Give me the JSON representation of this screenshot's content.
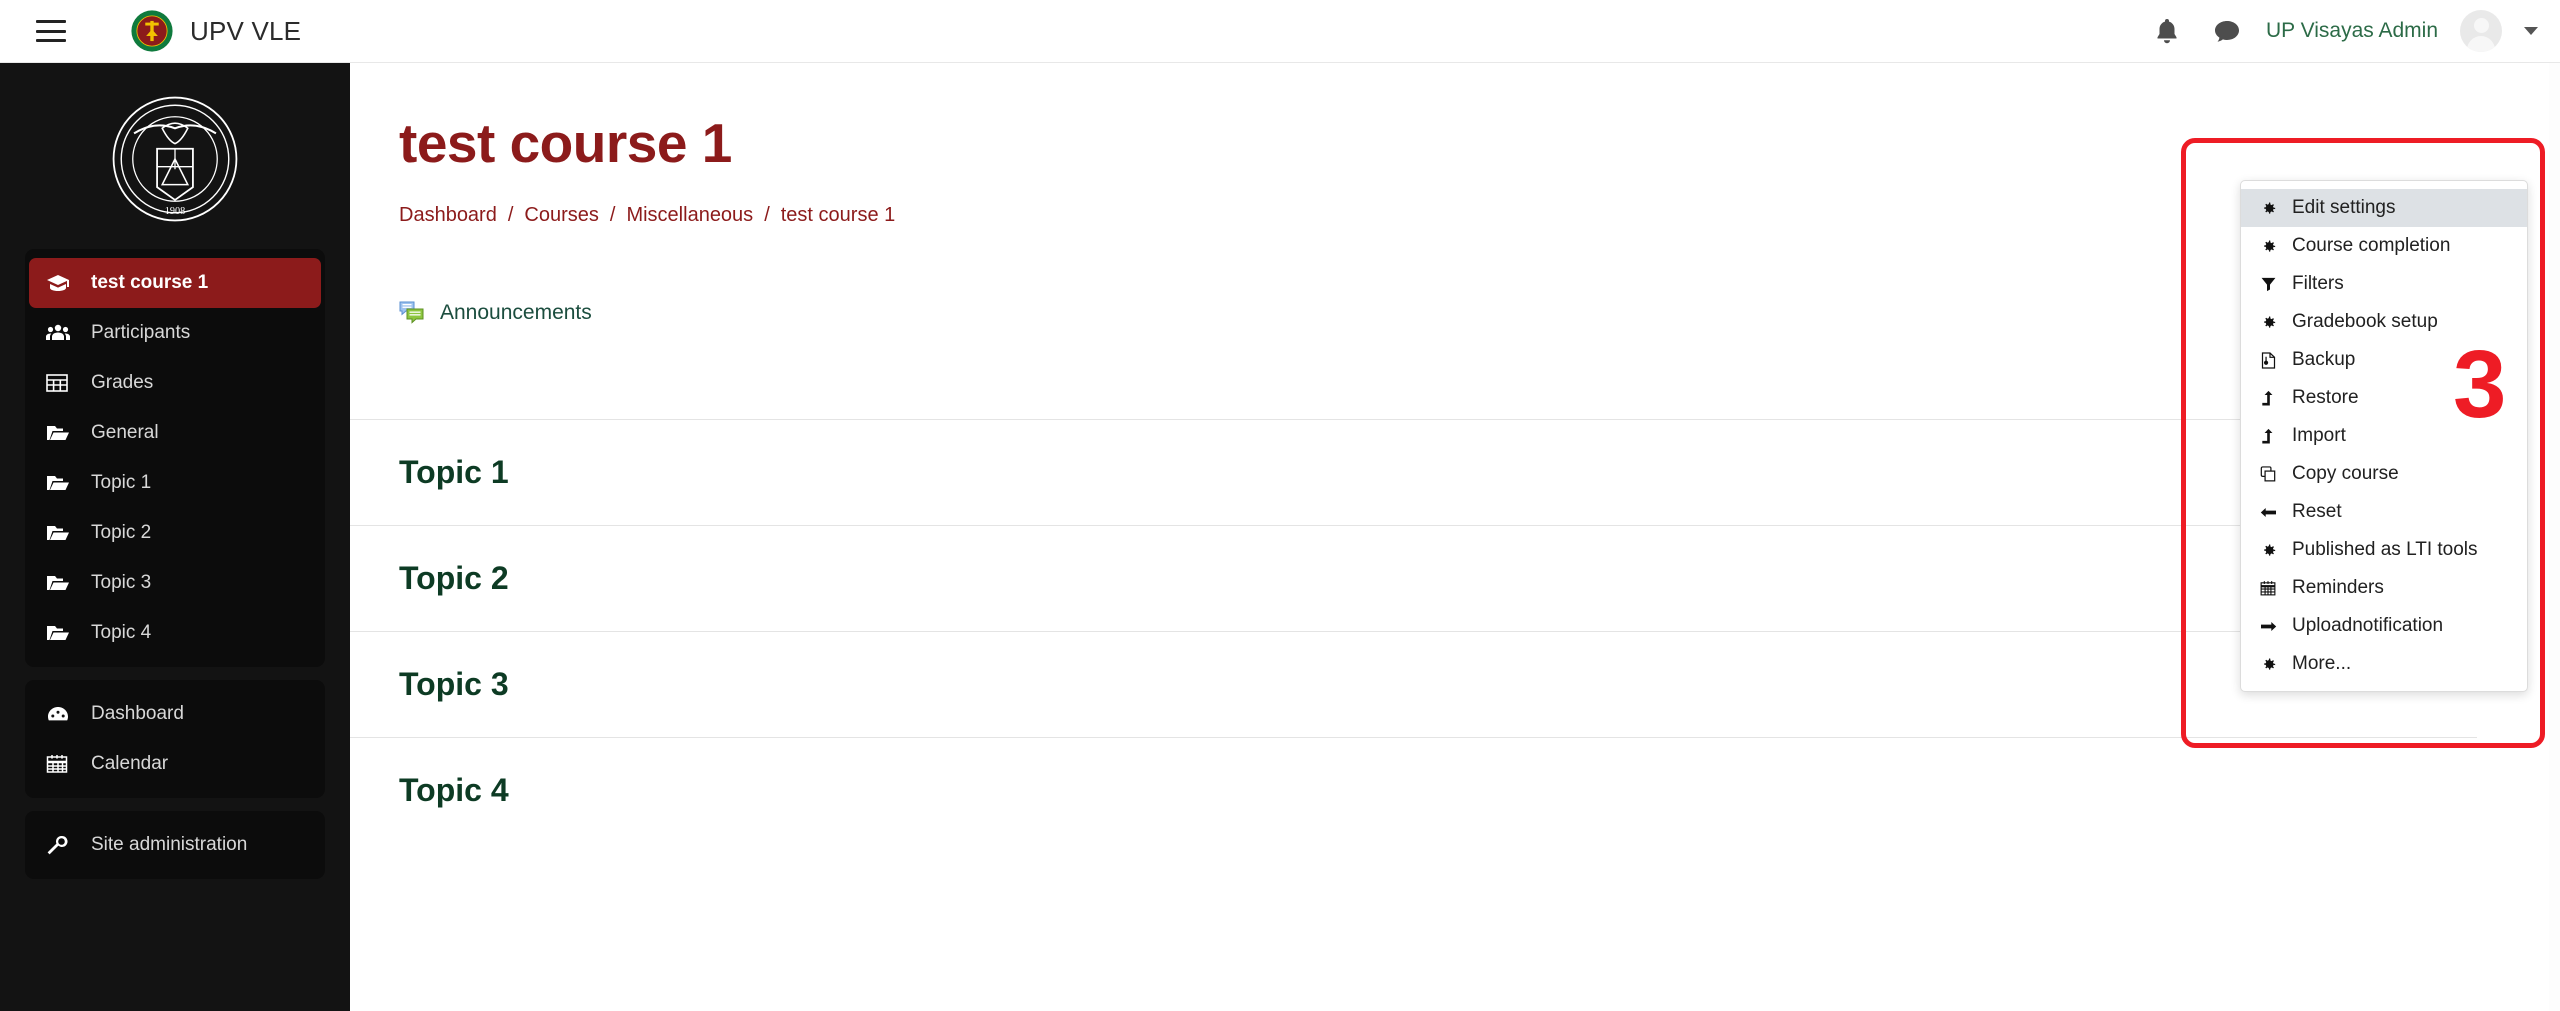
{
  "header": {
    "menu_toggle": "hamburger-menu",
    "site_name": "UPV VLE",
    "notifications_icon": "bell-icon",
    "messages_icon": "message-icon",
    "user_name": "UP Visayas Admin",
    "avatar": "user-avatar",
    "user_caret": "chevron-down-icon"
  },
  "sidebar": {
    "logo_alt": "University of the Philippines seal 1908",
    "groups": [
      {
        "items": [
          {
            "label": "test course 1",
            "icon": "graduation-cap-icon",
            "active": true
          },
          {
            "label": "Participants",
            "icon": "people-icon",
            "active": false
          },
          {
            "label": "Grades",
            "icon": "grid-table-icon",
            "active": false
          },
          {
            "label": "General",
            "icon": "folder-open-icon",
            "active": false
          },
          {
            "label": "Topic 1",
            "icon": "folder-open-icon",
            "active": false
          },
          {
            "label": "Topic 2",
            "icon": "folder-open-icon",
            "active": false
          },
          {
            "label": "Topic 3",
            "icon": "folder-open-icon",
            "active": false
          },
          {
            "label": "Topic 4",
            "icon": "folder-open-icon",
            "active": false
          }
        ]
      },
      {
        "items": [
          {
            "label": "Dashboard",
            "icon": "dashboard-gauge-icon",
            "active": false
          },
          {
            "label": "Calendar",
            "icon": "calendar-icon",
            "active": false
          }
        ]
      },
      {
        "items": [
          {
            "label": "Site administration",
            "icon": "wrench-icon",
            "active": false
          }
        ]
      }
    ]
  },
  "main": {
    "course_title": "test course 1",
    "breadcrumb": [
      {
        "label": "Dashboard",
        "current": false
      },
      {
        "label": "Courses",
        "current": false
      },
      {
        "label": "Miscellaneous",
        "current": false
      },
      {
        "label": "test course 1",
        "current": true
      }
    ],
    "breadcrumb_separator": "/",
    "settings_gear_icon": "gear-icon",
    "settings_caret_icon": "caret-down-icon",
    "announcement": {
      "icon": "forum-announcement-icon",
      "label": "Announcements"
    },
    "topics": [
      {
        "title": "Topic 1"
      },
      {
        "title": "Topic 2"
      },
      {
        "title": "Topic 3"
      },
      {
        "title": "Topic 4"
      }
    ]
  },
  "course_menu": {
    "items": [
      {
        "label": "Edit settings",
        "icon": "gear-icon",
        "highlight": true
      },
      {
        "label": "Course completion",
        "icon": "gear-icon",
        "highlight": false
      },
      {
        "label": "Filters",
        "icon": "funnel-icon",
        "highlight": false
      },
      {
        "label": "Gradebook setup",
        "icon": "gear-icon",
        "highlight": false
      },
      {
        "label": "Backup",
        "icon": "file-backup-icon",
        "highlight": false
      },
      {
        "label": "Restore",
        "icon": "arrow-up-icon",
        "highlight": false
      },
      {
        "label": "Import",
        "icon": "arrow-up-icon",
        "highlight": false
      },
      {
        "label": "Copy course",
        "icon": "copy-icon",
        "highlight": false
      },
      {
        "label": "Reset",
        "icon": "arrow-left-icon",
        "highlight": false
      },
      {
        "label": "Published as LTI tools",
        "icon": "gear-icon",
        "highlight": false
      },
      {
        "label": "Reminders",
        "icon": "calendar-icon",
        "highlight": false
      },
      {
        "label": "Uploadnotification",
        "icon": "arrow-right-icon",
        "highlight": false
      },
      {
        "label": "More...",
        "icon": "gear-icon",
        "highlight": false
      }
    ]
  },
  "annotations": {
    "step_number": "3",
    "highlight_color": "#ee1c25"
  },
  "colors": {
    "brand_maroon": "#8c1b1b",
    "topic_green": "#0d3b24",
    "user_green": "#2c6b47",
    "sidebar_bg": "#131313"
  }
}
